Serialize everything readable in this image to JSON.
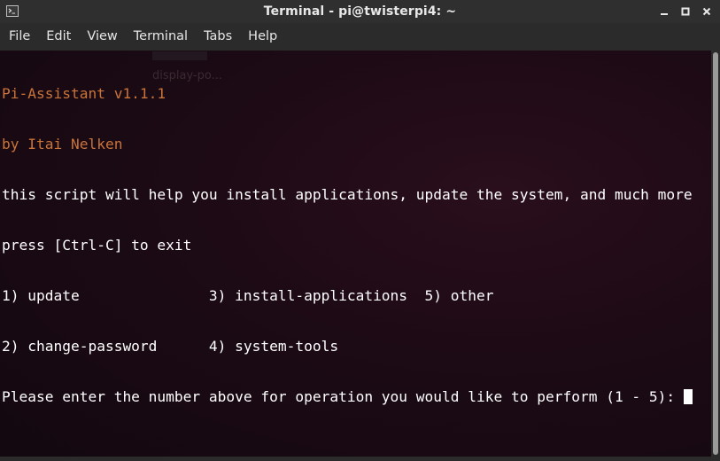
{
  "window": {
    "title": "Terminal - pi@twisterpi4: ~",
    "icon": "terminal-icon"
  },
  "controls": {
    "minimize": "minimize-icon",
    "maximize": "maximize-icon",
    "close": "close-icon"
  },
  "menu": {
    "items": [
      "File",
      "Edit",
      "View",
      "Terminal",
      "Tabs",
      "Help"
    ]
  },
  "terminal": {
    "lines": {
      "l0": "Pi-Assistant v1.1.1",
      "l1": "by Itai Nelken",
      "l2": "this script will help you install applications, update the system, and much more",
      "l3": "press [Ctrl-C] to exit",
      "l4": "1) update               3) install-applications  5) other",
      "l5": "2) change-password      4) system-tools",
      "l6": "Please enter the number above for operation you would like to perform (1 - 5): "
    },
    "ghost_text": "display-po...",
    "colors": {
      "banner": "#c9743a",
      "text": "#ffffff",
      "background": "#1c0a14"
    }
  }
}
